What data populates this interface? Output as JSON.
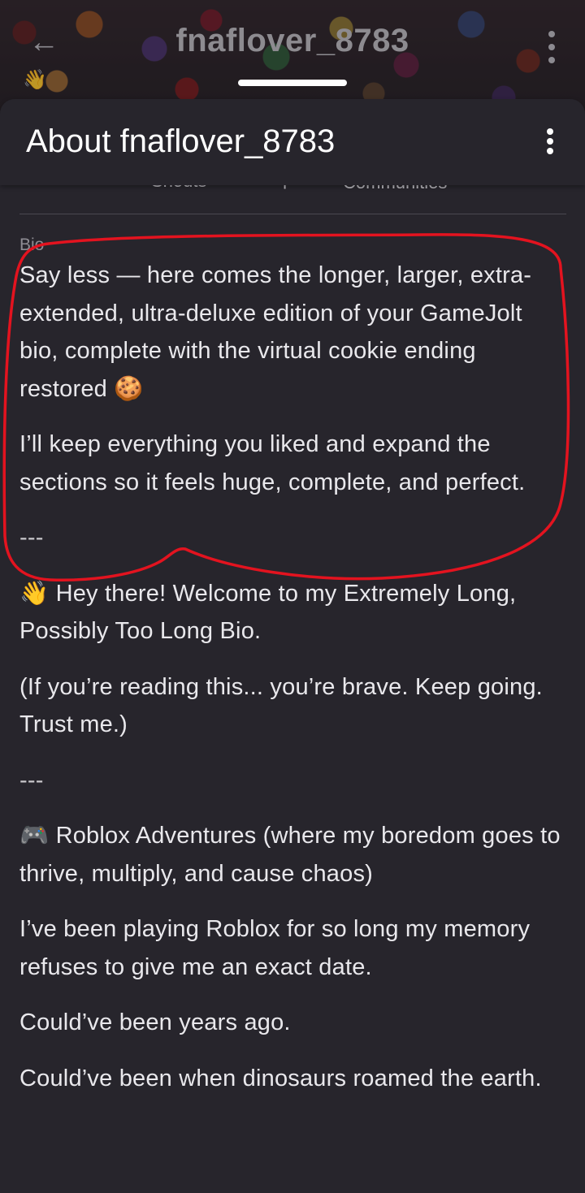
{
  "top_bar": {
    "username": "fnaflover_8783",
    "back_icon": "arrow-left-icon",
    "more_icon": "more-vertical-icon"
  },
  "sheet": {
    "title": "About fnaflover_8783",
    "more_icon": "more-vertical-icon",
    "tabs": [
      "Shouts",
      "Trophies",
      "Communities"
    ]
  },
  "bio": {
    "label": "Bio",
    "paragraphs": [
      "Say less — here comes the longer, larger, extra-extended, ultra-deluxe edition of your GameJolt bio, complete with the virtual cookie ending restored 🍪",
      "I’ll keep everything you liked and expand the sections so it feels huge, complete, and perfect.",
      "---",
      "👋 Hey there! Welcome to my Extremely Long, Possibly Too Long Bio.",
      "(If you’re reading this... you’re brave. Keep going. Trust me.)",
      "---",
      "🎮 Roblox Adventures (where my boredom goes to thrive, multiply, and cause chaos)",
      "I’ve been playing Roblox for so long my memory refuses to give me an exact date.",
      "Could’ve been years ago.",
      "Could’ve been when dinosaurs roamed the earth."
    ]
  },
  "annotation_color": "#e3131f"
}
